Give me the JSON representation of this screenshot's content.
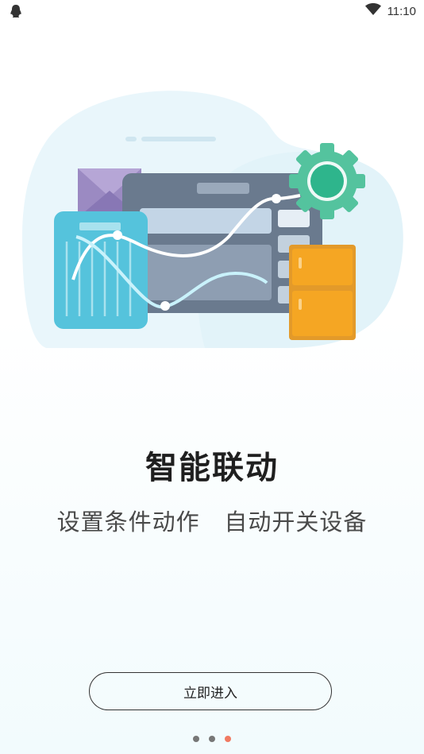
{
  "status_bar": {
    "time": "11:10",
    "left_icon": "qq-penguin-icon",
    "wifi_icon": "wifi-icon"
  },
  "onboarding": {
    "illustration_icon": "smart-linkage-illustration",
    "title": "智能联动",
    "subtitle": "设置条件动作   自动开关设备",
    "enter_button_label": "立即进入",
    "pagination": {
      "total": 3,
      "current": 3
    }
  },
  "colors": {
    "accent_dot": "#f07a62",
    "inactive_dot": "#777777"
  }
}
